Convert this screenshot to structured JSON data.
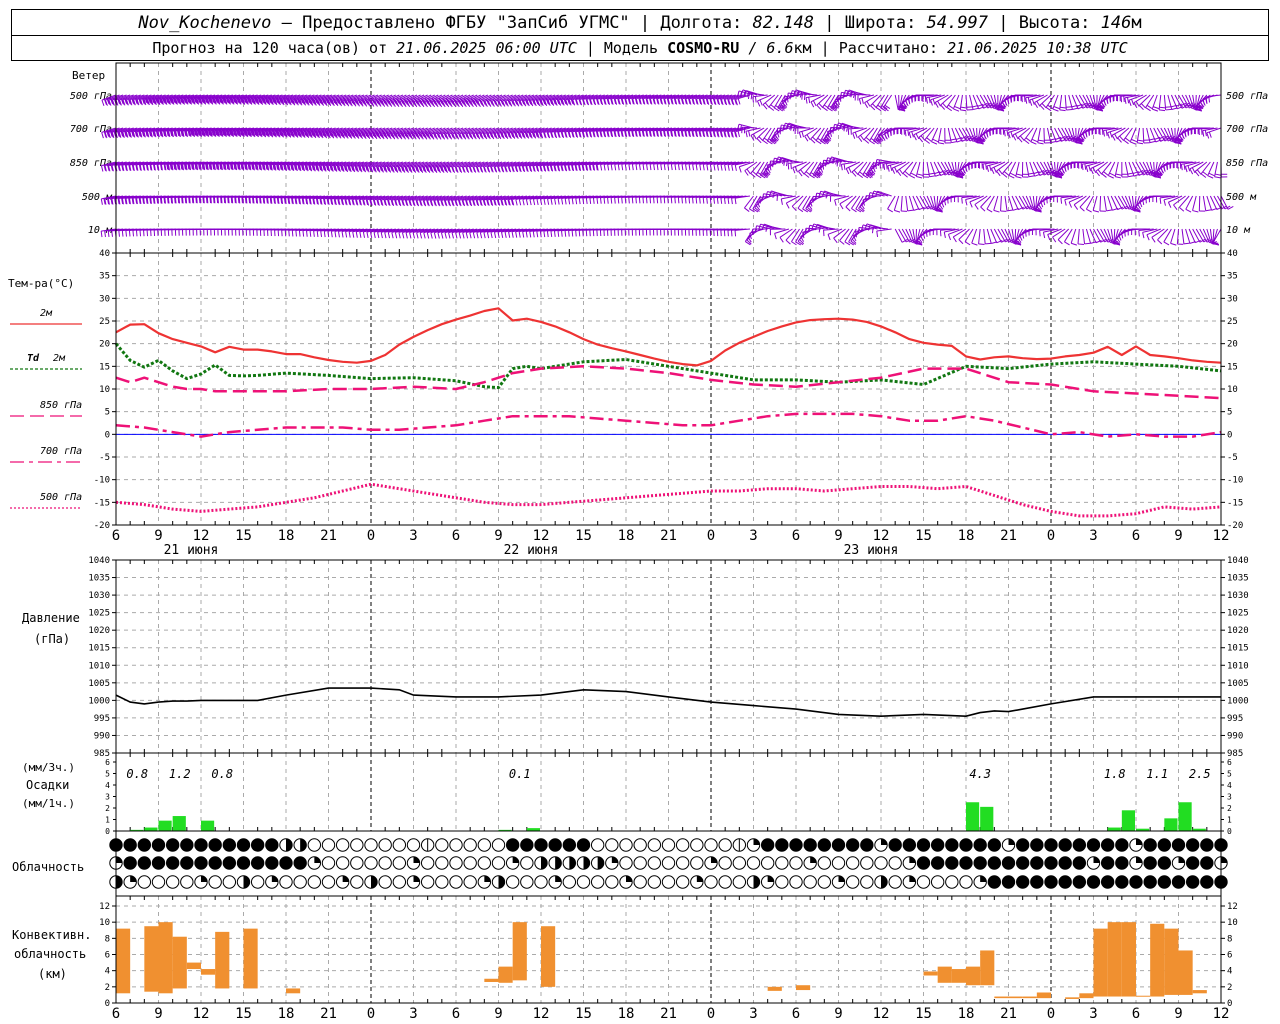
{
  "header": {
    "station": "Nov_Kochenevo",
    "provider": "Предоставлено ФГБУ \"ЗапСиб УГМС\"",
    "lon_label": "Долгота:",
    "lon": "82.148",
    "lat_label": "Широта:",
    "lat": "54.997",
    "alt_label": "Высота:",
    "alt": "146",
    "alt_unit": "м",
    "forecast_prefix": "Прогноз на 120 часа(ов) от",
    "forecast_start": "21.06.2025 06:00 UTC",
    "model_label": "Модель",
    "model": "COSMO-RU",
    "model_res": "/ 6.6",
    "model_res_unit": "км",
    "calc_label": "Рассчитано:",
    "calc_time": "21.06.2025 10:38 UTC"
  },
  "colors": {
    "wind": "#8800cc",
    "t2m": "#ee3333",
    "td2m": "#117711",
    "t850": "#ee1177",
    "t700": "#ee1177",
    "t500": "#ee1177",
    "zero": "#0000ff",
    "precip": "#22dd22",
    "conv": "#f09030",
    "grid": "#aaaaaa"
  },
  "wind": {
    "title": "Ветер",
    "levels": [
      "500 гПа",
      "700 гПа",
      "850 гПа",
      "500 м",
      "10 м"
    ],
    "right_levels": [
      "500 гПа",
      "700 гПа",
      "850 гПа",
      "500 м",
      "10 м"
    ]
  },
  "temp_panel": {
    "ylabel": "Тем-ра(°C)",
    "legend": [
      {
        "key": "t2m",
        "label": "2м",
        "prefix": ""
      },
      {
        "key": "td2m",
        "label": "2м",
        "prefix": "Td"
      },
      {
        "key": "t850",
        "label": "850 гПа",
        "prefix": ""
      },
      {
        "key": "t700",
        "label": "700 гПа",
        "prefix": ""
      },
      {
        "key": "t500",
        "label": "500 гПа",
        "prefix": ""
      }
    ]
  },
  "pressure_panel": {
    "ylabel_1": "Давление",
    "ylabel_2": "(гПа)"
  },
  "precip_panel": {
    "ylabel_1": "(мм/3ч.)",
    "ylabel_2": "Осадки",
    "ylabel_3": "(мм/1ч.)"
  },
  "cloud_panel": {
    "ylabel": "Облачность"
  },
  "conv_panel": {
    "ylabel_1": "Конвективн.",
    "ylabel_2": "облачность",
    "ylabel_3": "(км)"
  },
  "chart_data": [
    {
      "type": "line",
      "name": "temperature",
      "x_unit": "hours since forecast start (21.06.2025 06 UTC)",
      "x": [
        0,
        3,
        6,
        9,
        12,
        15,
        18,
        21,
        24,
        27,
        30,
        33,
        36,
        39,
        42,
        45,
        48,
        51,
        54,
        57,
        60,
        63,
        66,
        69,
        72,
        75,
        78
      ],
      "x_ticks": [
        "6",
        "9",
        "12",
        "15",
        "18",
        "21",
        "0",
        "3",
        "6",
        "9",
        "12",
        "15",
        "18",
        "21",
        "0",
        "3",
        "6",
        "9",
        "12",
        "15",
        "18",
        "21",
        "0",
        "3",
        "6",
        "9",
        "12"
      ],
      "date_labels": [
        "21 июня",
        "22 июня",
        "23 июня"
      ],
      "ylim": [
        -20,
        40
      ],
      "yticks": [
        -20,
        -15,
        -10,
        -5,
        0,
        5,
        10,
        15,
        20,
        25,
        30,
        35,
        40
      ],
      "series": [
        {
          "key": "t2m",
          "name": "2м",
          "x": [
            0,
            1,
            2,
            3,
            4,
            5,
            6,
            7,
            8,
            9,
            10,
            11,
            12,
            13,
            14,
            15,
            16,
            17,
            18,
            19,
            20,
            21,
            22,
            23,
            24,
            25,
            26,
            27,
            28,
            29,
            30,
            31,
            32,
            33,
            34,
            35,
            36,
            37,
            38,
            39,
            40,
            41,
            42,
            43,
            44,
            45,
            46,
            47,
            48,
            49,
            50,
            51,
            52,
            53,
            54,
            55,
            56,
            57,
            58,
            59,
            60,
            61,
            62,
            63,
            64,
            65,
            66,
            67,
            68,
            69,
            70,
            71,
            72,
            73,
            74,
            75,
            76,
            77,
            78
          ],
          "values": [
            22.5,
            24.2,
            24.3,
            22.3,
            21.0,
            20.2,
            19.4,
            18.1,
            19.3,
            18.7,
            18.7,
            18.3,
            17.7,
            17.7,
            17.0,
            16.4,
            16.0,
            15.8,
            16.2,
            17.5,
            19.8,
            21.5,
            23.0,
            24.3,
            25.3,
            26.2,
            27.2,
            27.8,
            25.1,
            25.5,
            24.8,
            23.8,
            22.5,
            21.0,
            19.8,
            19.0,
            18.3,
            17.5,
            16.7,
            16.0,
            15.5,
            15.2,
            16.2,
            18.5,
            20.2,
            21.5,
            22.8,
            23.8,
            24.7,
            25.2,
            25.4,
            25.5,
            25.3,
            24.8,
            23.8,
            22.5,
            21.0,
            20.2,
            19.8,
            19.5,
            17.2,
            16.5,
            17.0,
            17.2,
            16.8,
            16.6,
            16.7,
            17.2,
            17.5,
            18.0,
            19.3,
            17.5,
            19.4,
            17.5,
            17.2,
            16.8,
            16.3,
            16.0,
            15.8
          ],
          "style": "solid",
          "width": 2.2
        },
        {
          "key": "td2m",
          "name": "Td 2м",
          "x": [
            0,
            1,
            2,
            3,
            4,
            5,
            6,
            7,
            8,
            9,
            10,
            12,
            15,
            18,
            21,
            24,
            26,
            27,
            28,
            29,
            30,
            33,
            36,
            39,
            42,
            45,
            48,
            51,
            54,
            57,
            60,
            63,
            66,
            69,
            72,
            75,
            78
          ],
          "values": [
            20.0,
            16.3,
            14.8,
            16.3,
            14.0,
            12.3,
            13.3,
            15.3,
            13.0,
            12.9,
            13.0,
            13.5,
            13.0,
            12.3,
            12.5,
            11.8,
            10.5,
            10.3,
            14.5,
            15.0,
            14.5,
            16.0,
            16.5,
            15.0,
            13.5,
            12.0,
            12.0,
            11.5,
            12.0,
            11.0,
            15.0,
            14.5,
            15.5,
            16.0,
            15.5,
            15.0,
            14.0
          ],
          "style": "dotted",
          "width": 3
        },
        {
          "key": "t850",
          "name": "850 гПа",
          "x": [
            0,
            1,
            2,
            3,
            4,
            5,
            6,
            7,
            8,
            9,
            10,
            12,
            15,
            18,
            21,
            24,
            26,
            27,
            28,
            29,
            30,
            33,
            36,
            39,
            42,
            45,
            48,
            51,
            54,
            57,
            60,
            63,
            66,
            69,
            72,
            75,
            78
          ],
          "values": [
            12.5,
            11.5,
            12.5,
            11.5,
            10.5,
            10.0,
            10.0,
            9.5,
            9.5,
            9.5,
            9.5,
            9.5,
            10.0,
            10.0,
            10.5,
            10.0,
            11.5,
            12.5,
            13.5,
            14.0,
            14.5,
            15.0,
            14.5,
            13.5,
            12.0,
            11.0,
            10.5,
            11.5,
            12.5,
            14.5,
            14.5,
            11.5,
            11.0,
            9.5,
            9.0,
            8.5,
            8.0
          ],
          "style": "dashed",
          "width": 2.5
        },
        {
          "key": "t700",
          "name": "700 гПа",
          "x": [
            0,
            2,
            4,
            6,
            8,
            10,
            12,
            14,
            16,
            18,
            20,
            22,
            24,
            26,
            28,
            30,
            32,
            34,
            36,
            38,
            40,
            42,
            44,
            46,
            48,
            50,
            52,
            54,
            56,
            58,
            60,
            62,
            64,
            66,
            68,
            70,
            72,
            74,
            76,
            78
          ],
          "values": [
            2.0,
            1.5,
            0.5,
            -0.5,
            0.5,
            1.0,
            1.5,
            1.5,
            1.5,
            1.0,
            1.0,
            1.5,
            2.0,
            3.0,
            4.0,
            4.0,
            4.0,
            3.5,
            3.0,
            2.5,
            2.0,
            2.0,
            3.0,
            4.0,
            4.5,
            4.5,
            4.5,
            4.0,
            3.0,
            3.0,
            4.0,
            3.0,
            1.5,
            0.0,
            0.5,
            -0.5,
            0.0,
            -0.5,
            -0.5,
            0.5
          ],
          "style": "dashdot",
          "width": 2.5
        },
        {
          "key": "t500",
          "name": "500 гПа",
          "x": [
            0,
            2,
            4,
            6,
            8,
            10,
            12,
            14,
            16,
            18,
            20,
            22,
            24,
            26,
            28,
            30,
            32,
            34,
            36,
            38,
            40,
            42,
            44,
            46,
            48,
            50,
            52,
            54,
            56,
            58,
            60,
            62,
            64,
            66,
            68,
            70,
            72,
            74,
            76,
            78
          ],
          "values": [
            -15.0,
            -15.5,
            -16.5,
            -17.0,
            -16.5,
            -16.0,
            -15.0,
            -14.0,
            -12.5,
            -11.0,
            -12.0,
            -13.0,
            -14.0,
            -15.0,
            -15.5,
            -15.5,
            -15.0,
            -14.5,
            -14.0,
            -13.5,
            -13.0,
            -12.5,
            -12.5,
            -12.0,
            -12.0,
            -12.5,
            -12.0,
            -11.5,
            -11.5,
            -12.0,
            -11.5,
            -13.5,
            -15.5,
            -17.0,
            -18.0,
            -18.0,
            -17.5,
            -16.0,
            -16.5,
            -16.0
          ],
          "style": "fine-dotted",
          "width": 3
        }
      ]
    },
    {
      "type": "line",
      "name": "pressure",
      "ylim": [
        985,
        1040
      ],
      "yticks": [
        985,
        990,
        995,
        1000,
        1005,
        1010,
        1015,
        1020,
        1025,
        1030,
        1035,
        1040
      ],
      "series": [
        {
          "key": "pressure",
          "name": "Давление",
          "x": [
            0,
            1,
            2,
            3,
            4,
            5,
            6,
            7,
            8,
            9,
            10,
            12,
            15,
            18,
            20,
            21,
            24,
            27,
            30,
            33,
            36,
            39,
            42,
            45,
            48,
            51,
            54,
            57,
            60,
            61,
            62,
            63,
            64,
            66,
            69,
            72,
            75,
            78
          ],
          "values": [
            1001.5,
            999.5,
            999.0,
            999.5,
            999.8,
            999.8,
            1000.0,
            1000.0,
            1000.0,
            1000.0,
            1000.0,
            1001.5,
            1003.5,
            1003.5,
            1003.0,
            1001.5,
            1001.0,
            1001.0,
            1001.5,
            1003.0,
            1002.5,
            1001.0,
            999.5,
            998.5,
            997.5,
            996.0,
            995.5,
            996.0,
            995.5,
            996.5,
            997.0,
            996.8,
            997.5,
            999.0,
            1001.0,
            1001.0,
            1001.0,
            1001.0
          ],
          "style": "solid",
          "width": 1.6
        }
      ]
    },
    {
      "type": "bar",
      "name": "precipitation",
      "unit": "мм/1ч.",
      "ylim": [
        0,
        6
      ],
      "yticks": [
        0,
        1,
        2,
        3,
        4,
        5,
        6
      ],
      "bars": [
        [
          1,
          0.1
        ],
        [
          2,
          0.3
        ],
        [
          3,
          0.9
        ],
        [
          4,
          1.3
        ],
        [
          6,
          0.9
        ],
        [
          27,
          0.1
        ],
        [
          29,
          0.25
        ],
        [
          60,
          2.5
        ],
        [
          61,
          2.1
        ],
        [
          70,
          0.3
        ],
        [
          71,
          1.8
        ],
        [
          72,
          0.2
        ],
        [
          74,
          1.1
        ],
        [
          75,
          2.5
        ],
        [
          76,
          0.2
        ]
      ],
      "totals_3h": [
        [
          "0.8",
          1.5
        ],
        [
          "1.2",
          4.5
        ],
        [
          "0.8",
          7.5
        ],
        [
          "0.1",
          28.5
        ],
        [
          "4.3",
          61.0
        ],
        [
          "1.8",
          70.5
        ],
        [
          "1.1",
          73.5
        ],
        [
          "2.5",
          76.5
        ]
      ]
    },
    {
      "type": "table",
      "name": "cloudiness",
      "rows": 3
    },
    {
      "type": "bar",
      "name": "convective cloud",
      "unit": "км",
      "ylim": [
        0,
        12
      ],
      "yticks": [
        0,
        2,
        4,
        6,
        8,
        10,
        12
      ],
      "segments": [
        [
          0,
          1.2,
          9.2
        ],
        [
          2,
          1.4,
          9.5
        ],
        [
          3,
          1.2,
          10
        ],
        [
          4,
          1.8,
          8.2
        ],
        [
          5,
          4.2,
          5.0
        ],
        [
          6,
          3.5,
          4.2
        ],
        [
          7,
          1.8,
          8.8
        ],
        [
          9,
          1.8,
          9.2
        ],
        [
          12,
          1.2,
          1.8
        ],
        [
          26,
          2.6,
          3.0
        ],
        [
          27,
          2.5,
          4.5
        ],
        [
          28,
          2.8,
          10
        ],
        [
          30,
          2.0,
          9.5
        ],
        [
          46,
          1.5,
          2.0
        ],
        [
          48,
          1.6,
          2.2
        ],
        [
          57,
          3.4,
          3.9
        ],
        [
          58,
          2.5,
          4.5
        ],
        [
          59,
          2.5,
          4.2
        ],
        [
          60,
          2.2,
          4.5
        ],
        [
          61,
          2.2,
          6.5
        ],
        [
          62,
          0.6,
          0.8
        ],
        [
          63,
          0.6,
          0.8
        ],
        [
          64,
          0.6,
          0.8
        ],
        [
          65,
          0.6,
          1.3
        ],
        [
          67,
          0.5,
          0.7
        ],
        [
          68,
          0.6,
          1.2
        ],
        [
          69,
          0.8,
          9.2
        ],
        [
          70,
          0.8,
          10
        ],
        [
          71,
          0.8,
          10
        ],
        [
          72,
          0.8,
          0.9
        ],
        [
          73,
          0.8,
          9.8
        ],
        [
          74,
          1.0,
          9.2
        ],
        [
          75,
          1.0,
          6.5
        ],
        [
          76,
          1.2,
          1.6
        ]
      ]
    }
  ]
}
